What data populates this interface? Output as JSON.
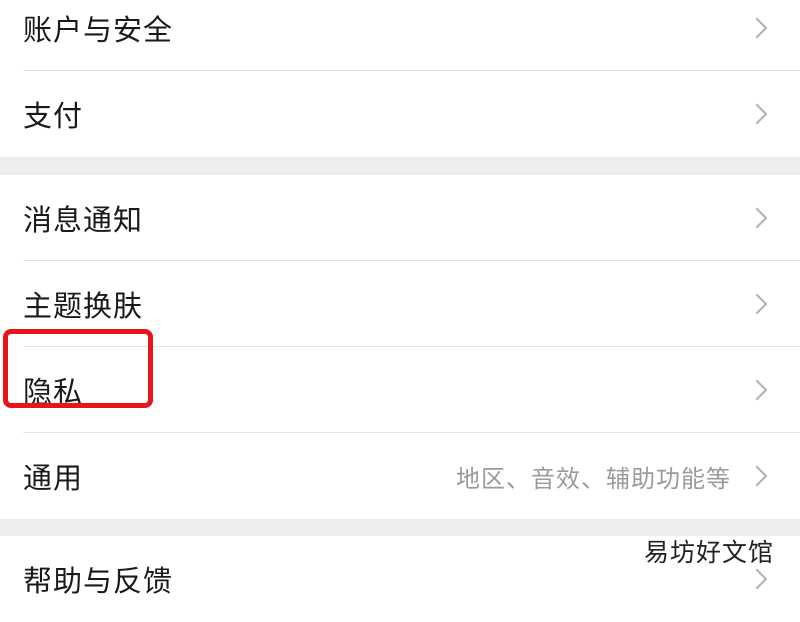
{
  "settings": {
    "groups": [
      {
        "items": [
          {
            "label": "账户与安全"
          },
          {
            "label": "支付"
          }
        ]
      },
      {
        "items": [
          {
            "label": "消息通知"
          },
          {
            "label": "主题换肤"
          },
          {
            "label": "隐私"
          },
          {
            "label": "通用",
            "hint": "地区、音效、辅助功能等"
          }
        ]
      },
      {
        "items": [
          {
            "label": "帮助与反馈"
          }
        ]
      }
    ],
    "chevron_icon": "chevron-right-icon",
    "highlighted_item": "隐私",
    "highlight_color": "#e8141c"
  },
  "watermark": "易坊好文馆"
}
